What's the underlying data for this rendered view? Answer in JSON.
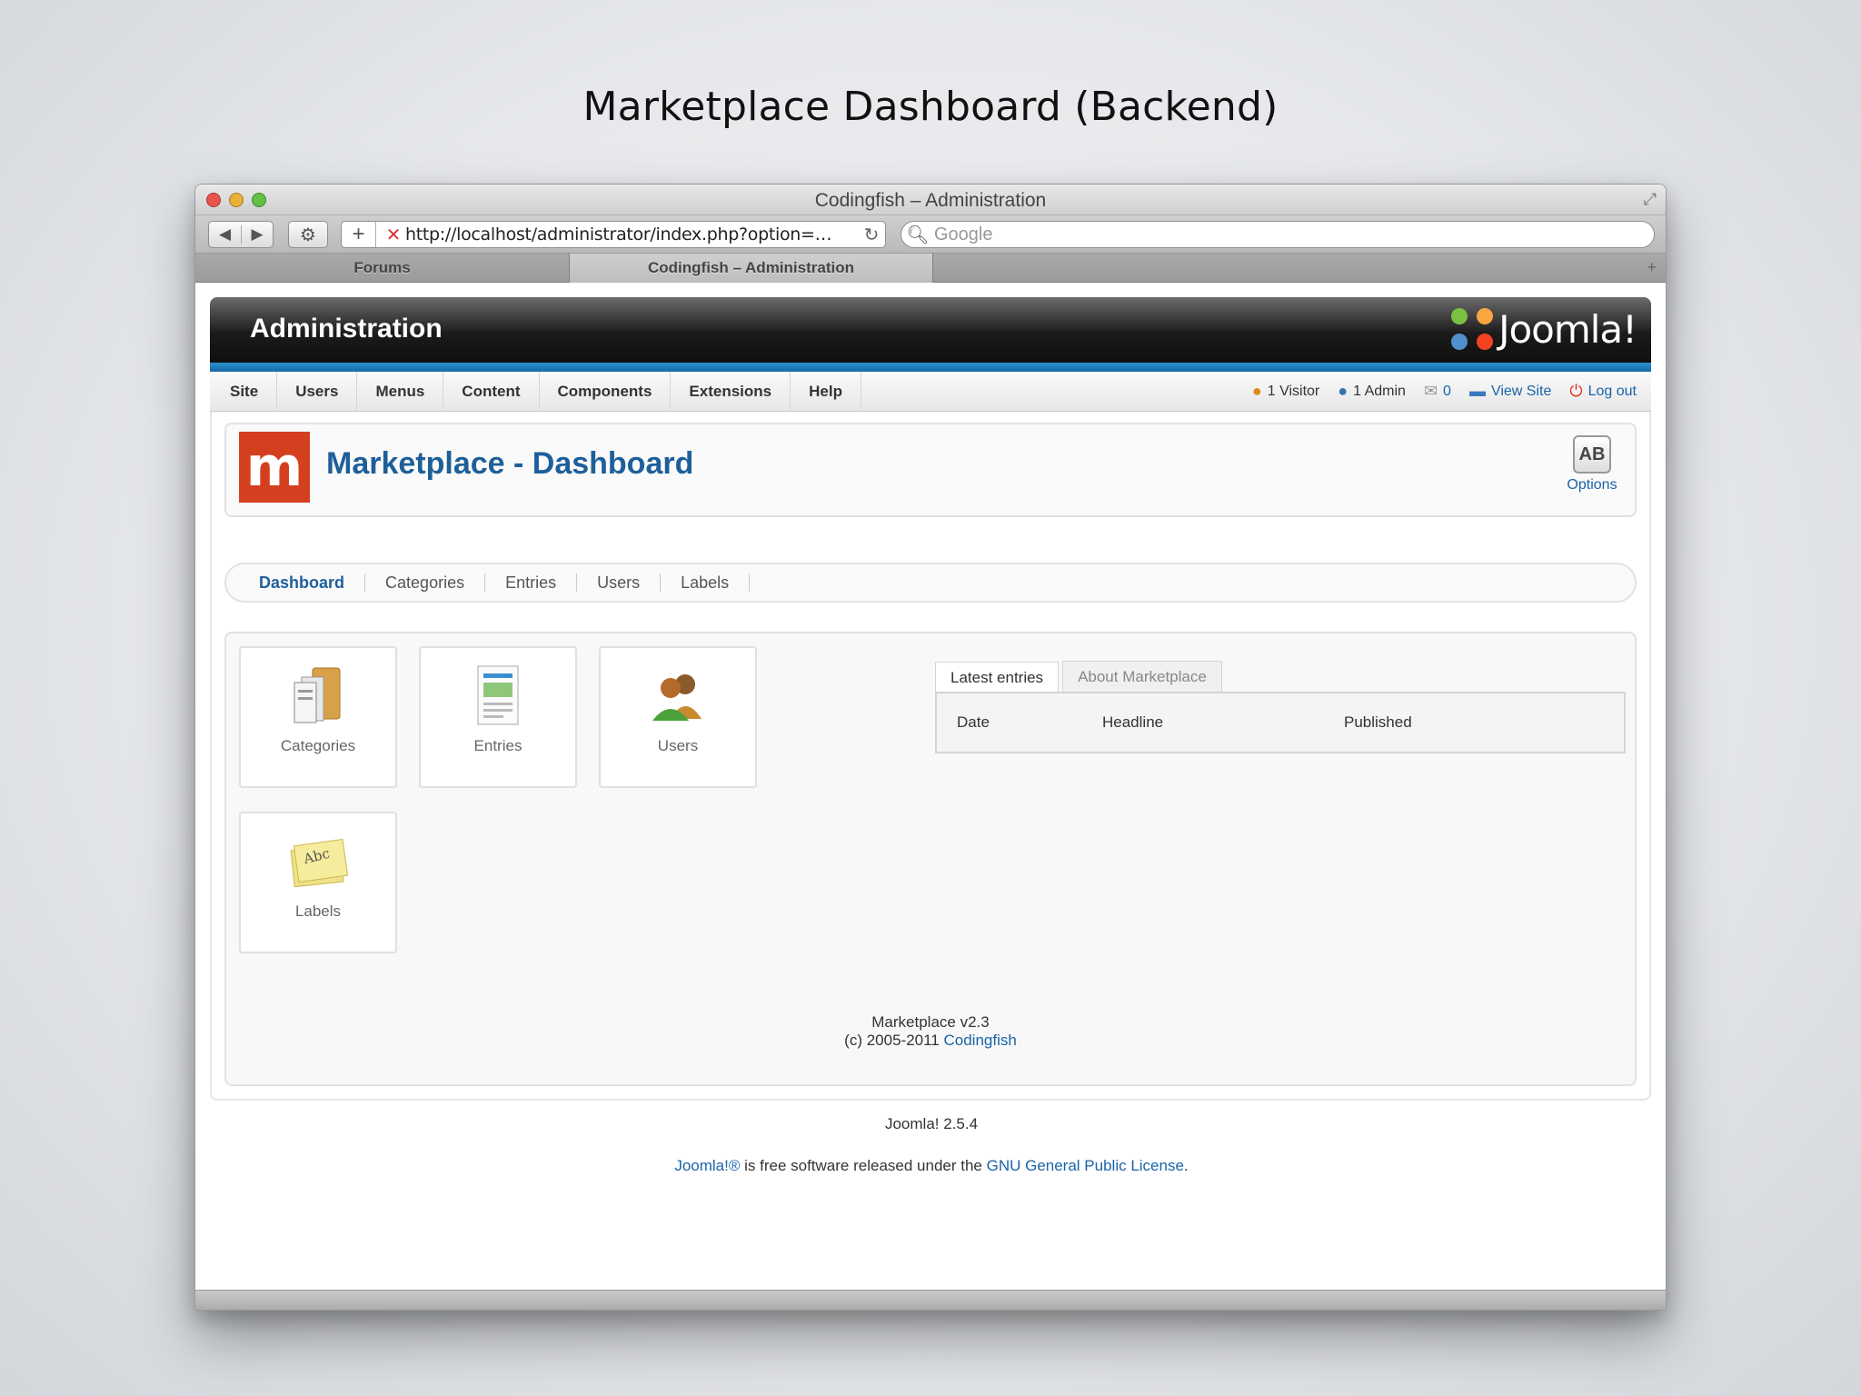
{
  "slide": {
    "title": "Marketplace Dashboard (Backend)"
  },
  "browser": {
    "window_title": "Codingfish – Administration",
    "url": "http://localhost/administrator/index.php?option=…",
    "search_placeholder": "Google",
    "tabs": [
      {
        "label": "Forums",
        "active": false
      },
      {
        "label": "Codingfish – Administration",
        "active": true
      }
    ]
  },
  "header": {
    "title": "Administration",
    "logo_text": "Joomla!"
  },
  "menu": {
    "items": [
      "Site",
      "Users",
      "Menus",
      "Content",
      "Components",
      "Extensions",
      "Help"
    ],
    "status": {
      "visitors": "1 Visitor",
      "admins": "1 Admin",
      "messages": "0",
      "view_site": "View Site",
      "logout": "Log out"
    }
  },
  "page": {
    "logo_letter": "m",
    "heading": "Marketplace - Dashboard",
    "options_label": "Options",
    "options_icon_text": "AB"
  },
  "subnav": {
    "items": [
      "Dashboard",
      "Categories",
      "Entries",
      "Users",
      "Labels"
    ],
    "active": "Dashboard"
  },
  "quick_buttons": {
    "categories": "Categories",
    "entries": "Entries",
    "users": "Users",
    "labels": "Labels",
    "labels_icon_text": "Abc"
  },
  "panel_tabs": {
    "tabs": [
      "Latest entries",
      "About Marketplace"
    ],
    "columns": [
      "Date",
      "Headline",
      "Published"
    ]
  },
  "version": {
    "line1": "Marketplace v2.3",
    "line2_prefix": "(c) 2005-2011 ",
    "line2_link": "Codingfish"
  },
  "footer": {
    "joomla_version": "Joomla! 2.5.4",
    "link1": "Joomla!®",
    "middle": " is free software released under the ",
    "link2": "GNU General Public License",
    "end": "."
  },
  "colors": {
    "accent_blue": "#1e5f9a",
    "link_blue": "#1a63a8",
    "stripe_blue": "#2a8fd0",
    "marketplace_red": "#d4401f"
  }
}
